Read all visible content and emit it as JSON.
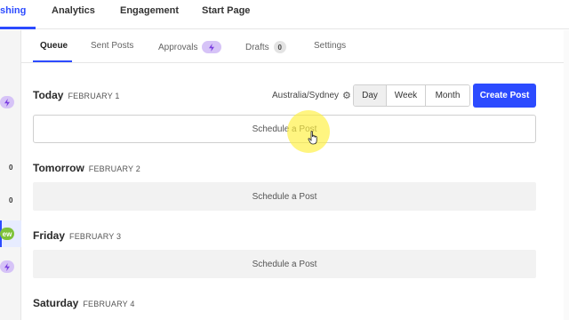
{
  "topnav": {
    "tabs": [
      {
        "label": "shing"
      },
      {
        "label": "Analytics"
      },
      {
        "label": "Engagement"
      },
      {
        "label": "Start Page"
      }
    ]
  },
  "sidebar": {
    "counts": [
      "0",
      "0"
    ],
    "new_badge": "ew"
  },
  "subtabs": {
    "queue": "Queue",
    "sent": "Sent Posts",
    "approvals": "Approvals",
    "drafts": "Drafts",
    "drafts_count": "0",
    "settings": "Settings"
  },
  "controls": {
    "timezone": "Australia/Sydney",
    "views": [
      "Day",
      "Week",
      "Month"
    ],
    "selected_view": "Day",
    "create_post": "Create Post"
  },
  "days": [
    {
      "name": "Today",
      "date": "FEBRUARY 1",
      "slot": "Schedule a Post"
    },
    {
      "name": "Tomorrow",
      "date": "FEBRUARY 2",
      "slot": "Schedule a Post"
    },
    {
      "name": "Friday",
      "date": "FEBRUARY 3",
      "slot": "Schedule a Post"
    },
    {
      "name": "Saturday",
      "date": "FEBRUARY 4"
    }
  ],
  "colors": {
    "accent": "#2c4bff",
    "approvals_badge": "#d6c3f7",
    "new_badge": "#7fc23a",
    "cursor_highlight": "#fff03c"
  },
  "icons": {
    "timezone_settings": "gear-icon",
    "approvals": "lightning-icon",
    "cursor": "hand-pointer-icon"
  }
}
